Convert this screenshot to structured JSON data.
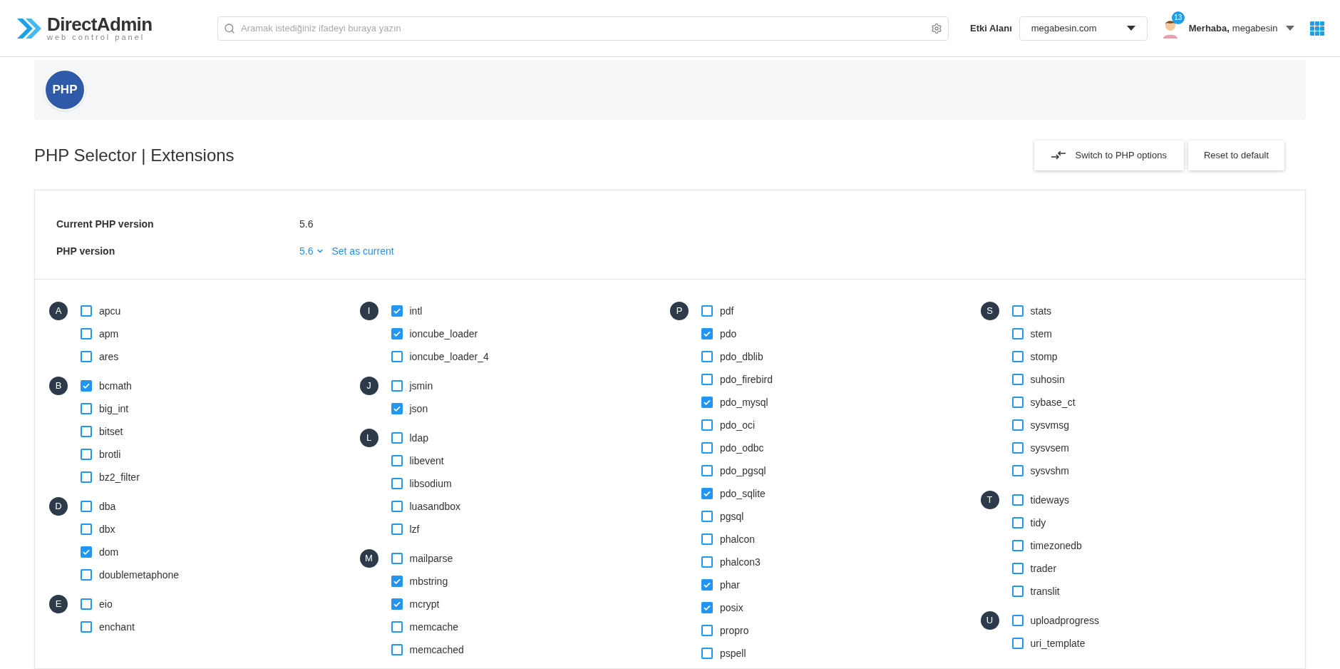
{
  "header": {
    "logo": {
      "name": "DirectAdmin",
      "tagline": "web control panel"
    },
    "search": {
      "placeholder": "Aramak istediğiniz ifadeyi buraya yazın"
    },
    "domain_label": "Etki Alanı",
    "domain_value": "megabesin.com",
    "notifications": "13",
    "greeting": "Merhaba,",
    "username": "megabesin"
  },
  "banner": {
    "logo_text": "PHP"
  },
  "page_title": "PHP Selector | Extensions",
  "buttons": [
    {
      "kind": "switch",
      "label": "Switch to PHP options"
    },
    {
      "kind": "plain",
      "label": "Reset to default"
    }
  ],
  "info": {
    "current_label": "Current PHP version",
    "current_value": "5.6",
    "version_label": "PHP version",
    "version_value": "5.6",
    "set_current": "Set as current"
  },
  "columns": [
    {
      "groups": [
        {
          "letter": "A",
          "items": [
            {
              "name": "apcu",
              "checked": false
            },
            {
              "name": "apm",
              "checked": false
            },
            {
              "name": "ares",
              "checked": false
            }
          ]
        },
        {
          "letter": "B",
          "items": [
            {
              "name": "bcmath",
              "checked": true
            },
            {
              "name": "big_int",
              "checked": false
            },
            {
              "name": "bitset",
              "checked": false
            },
            {
              "name": "brotli",
              "checked": false
            },
            {
              "name": "bz2_filter",
              "checked": false
            }
          ]
        },
        {
          "letter": "D",
          "items": [
            {
              "name": "dba",
              "checked": false
            },
            {
              "name": "dbx",
              "checked": false
            },
            {
              "name": "dom",
              "checked": true
            },
            {
              "name": "doublemetaphone",
              "checked": false
            }
          ]
        },
        {
          "letter": "E",
          "items": [
            {
              "name": "eio",
              "checked": false
            },
            {
              "name": "enchant",
              "checked": false
            }
          ]
        }
      ]
    },
    {
      "groups": [
        {
          "letter": "I",
          "items": [
            {
              "name": "intl",
              "checked": true
            },
            {
              "name": "ioncube_loader",
              "checked": true
            },
            {
              "name": "ioncube_loader_4",
              "checked": false
            }
          ]
        },
        {
          "letter": "J",
          "items": [
            {
              "name": "jsmin",
              "checked": false
            },
            {
              "name": "json",
              "checked": true
            }
          ]
        },
        {
          "letter": "L",
          "items": [
            {
              "name": "ldap",
              "checked": false
            },
            {
              "name": "libevent",
              "checked": false
            },
            {
              "name": "libsodium",
              "checked": false
            },
            {
              "name": "luasandbox",
              "checked": false
            },
            {
              "name": "lzf",
              "checked": false
            }
          ]
        },
        {
          "letter": "M",
          "items": [
            {
              "name": "mailparse",
              "checked": false
            },
            {
              "name": "mbstring",
              "checked": true
            },
            {
              "name": "mcrypt",
              "checked": true
            },
            {
              "name": "memcache",
              "checked": false
            },
            {
              "name": "memcached",
              "checked": false
            }
          ]
        }
      ]
    },
    {
      "groups": [
        {
          "letter": "P",
          "items": [
            {
              "name": "pdf",
              "checked": false
            },
            {
              "name": "pdo",
              "checked": true
            },
            {
              "name": "pdo_dblib",
              "checked": false
            },
            {
              "name": "pdo_firebird",
              "checked": false
            },
            {
              "name": "pdo_mysql",
              "checked": true
            },
            {
              "name": "pdo_oci",
              "checked": false
            },
            {
              "name": "pdo_odbc",
              "checked": false
            },
            {
              "name": "pdo_pgsql",
              "checked": false
            },
            {
              "name": "pdo_sqlite",
              "checked": true
            },
            {
              "name": "pgsql",
              "checked": false
            },
            {
              "name": "phalcon",
              "checked": false
            },
            {
              "name": "phalcon3",
              "checked": false
            },
            {
              "name": "phar",
              "checked": true
            },
            {
              "name": "posix",
              "checked": true
            },
            {
              "name": "propro",
              "checked": false
            },
            {
              "name": "pspell",
              "checked": false
            }
          ]
        }
      ]
    },
    {
      "groups": [
        {
          "letter": "S",
          "items": [
            {
              "name": "stats",
              "checked": false
            },
            {
              "name": "stem",
              "checked": false
            },
            {
              "name": "stomp",
              "checked": false
            },
            {
              "name": "suhosin",
              "checked": false
            },
            {
              "name": "sybase_ct",
              "checked": false
            },
            {
              "name": "sysvmsg",
              "checked": false
            },
            {
              "name": "sysvsem",
              "checked": false
            },
            {
              "name": "sysvshm",
              "checked": false
            }
          ]
        },
        {
          "letter": "T",
          "items": [
            {
              "name": "tideways",
              "checked": false
            },
            {
              "name": "tidy",
              "checked": false
            },
            {
              "name": "timezonedb",
              "checked": false
            },
            {
              "name": "trader",
              "checked": false
            },
            {
              "name": "translit",
              "checked": false
            }
          ]
        },
        {
          "letter": "U",
          "items": [
            {
              "name": "uploadprogress",
              "checked": false
            },
            {
              "name": "uri_template",
              "checked": false
            }
          ]
        }
      ]
    }
  ]
}
